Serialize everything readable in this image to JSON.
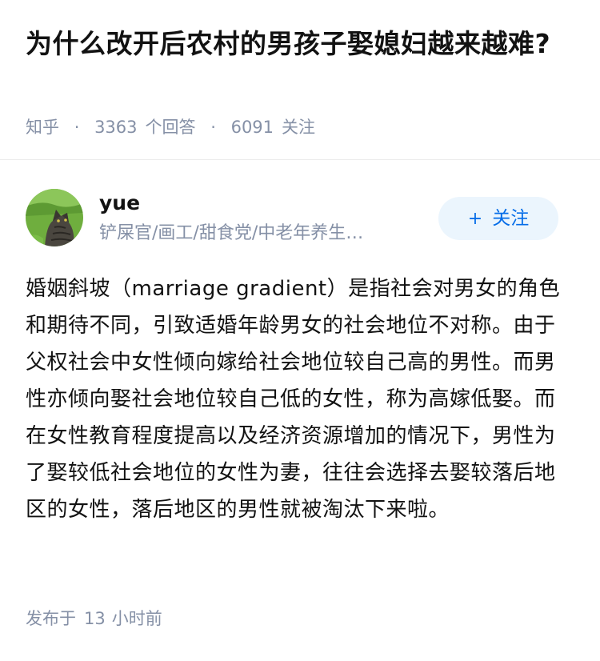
{
  "question": {
    "title": "为什么改开后农村的男孩子娶媳妇越来越难?",
    "source": "知乎",
    "answer_count": "3363",
    "answer_label": "个回答",
    "follower_count": "6091",
    "follower_label": "关注",
    "separator": "·"
  },
  "author": {
    "name": "yue",
    "bio": "铲屎官/画工/甜食党/中老年养生…",
    "avatar_icon": "cat-avatar-photo",
    "follow_button": {
      "icon": "+",
      "label": "关注"
    }
  },
  "answer": {
    "text": "婚姻斜坡（marriage gradient）是指社会对男女的角色和期待不同，引致适婚年龄男女的社会地位不对称。由于父权社会中女性倾向嫁给社会地位较自己高的男性。而男性亦倾向娶社会地位较自己低的女性，称为高嫁低娶。而在女性教育程度提高以及经济资源增加的情况下，男性为了娶较低社会地位的女性为妻，往往会选择去娶较落后地区的女性，落后地区的男性就被淘汰下来啦。"
  },
  "footer": {
    "posted_prefix": "发布于",
    "posted_number": "13",
    "posted_unit": "小时前"
  },
  "colors": {
    "text": "#121212",
    "muted": "#8590a6",
    "accent": "#056de8",
    "accent_bg": "#ebf5fd",
    "divider": "#ebebeb"
  }
}
